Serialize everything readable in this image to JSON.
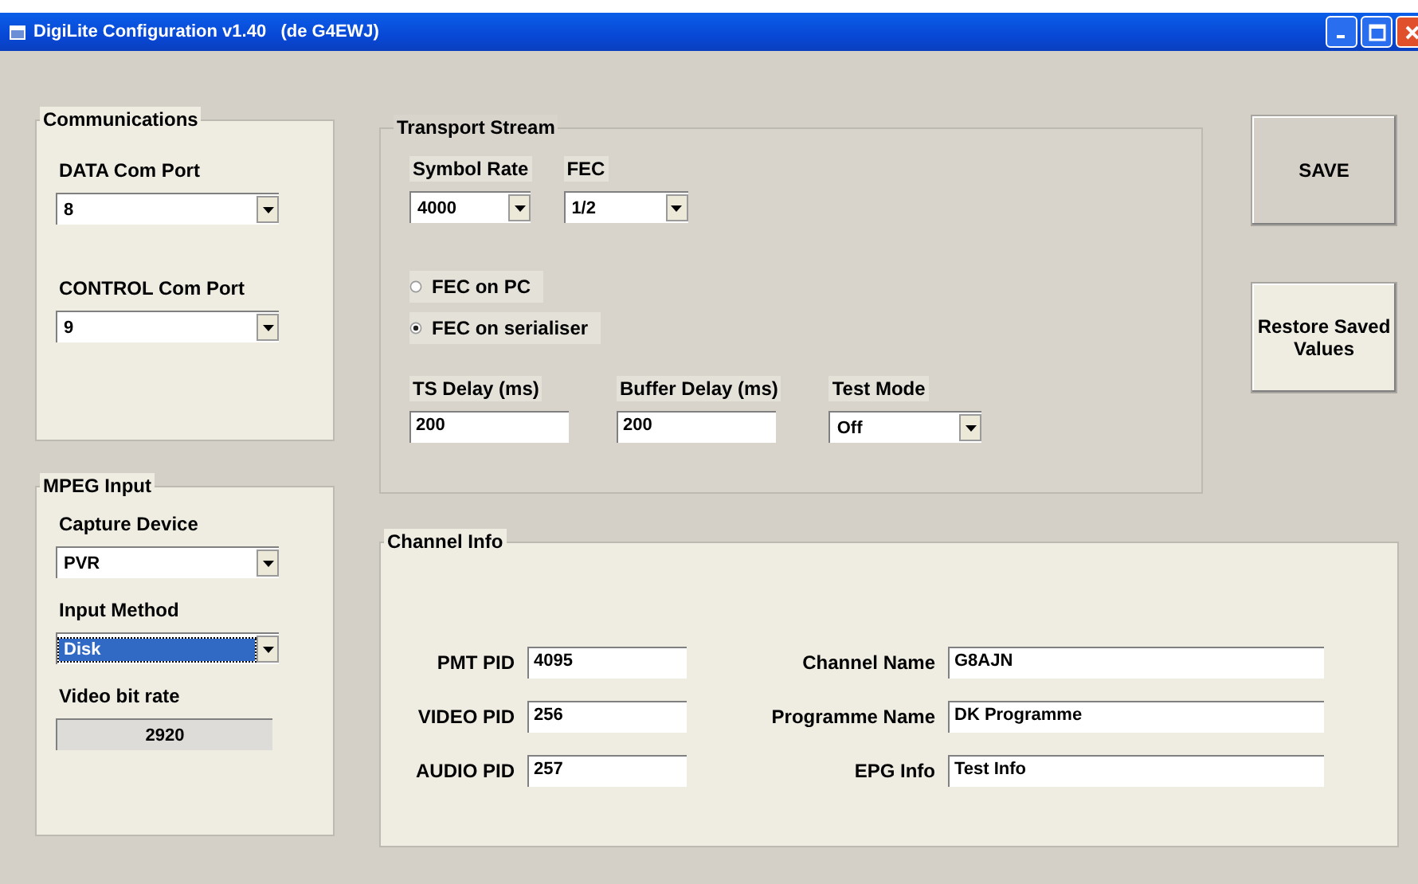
{
  "window": {
    "title": "DigiLite Configuration v1.40   (de G4EWJ)"
  },
  "communications": {
    "title": "Communications",
    "fields": [
      {
        "label": "DATA Com Port",
        "value": "8",
        "kind": "dropdown"
      },
      {
        "label": "CONTROL Com Port",
        "value": "9",
        "kind": "dropdown"
      }
    ]
  },
  "mpeg_input": {
    "title": "MPEG Input",
    "fields": [
      {
        "label": "Capture Device",
        "value": "PVR",
        "kind": "dropdown"
      },
      {
        "label": "Input Method",
        "value": "Disk",
        "kind": "dropdown",
        "focused": true
      },
      {
        "label": "Video bit rate",
        "value": "2920",
        "kind": "readout"
      }
    ]
  },
  "transport_stream": {
    "title": "Transport Stream",
    "top_fields": [
      {
        "label": "Symbol Rate",
        "value": "4000",
        "kind": "dropdown"
      },
      {
        "label": "FEC",
        "value": "1/2",
        "kind": "dropdown"
      }
    ],
    "fec_options": [
      {
        "label": "FEC on PC",
        "selected": false
      },
      {
        "label": "FEC on serialiser",
        "selected": true
      }
    ],
    "bottom_fields": [
      {
        "label": "TS Delay (ms)",
        "value": "200",
        "kind": "text"
      },
      {
        "label": "Buffer Delay (ms)",
        "value": "200",
        "kind": "text"
      },
      {
        "label": "Test Mode",
        "value": "Off",
        "kind": "dropdown"
      }
    ]
  },
  "buttons": [
    {
      "label": "SAVE",
      "hovered": false
    },
    {
      "label": "Restore Saved Values",
      "hovered": true
    }
  ],
  "channel_info": {
    "title": "Channel Info",
    "left_fields": [
      {
        "label": "PMT PID",
        "value": "4095"
      },
      {
        "label": "VIDEO PID",
        "value": "256"
      },
      {
        "label": "AUDIO PID",
        "value": "257"
      }
    ],
    "right_fields": [
      {
        "label": "Channel Name",
        "value": "G8AJN"
      },
      {
        "label": "Programme Name",
        "value": "DK Programme"
      },
      {
        "label": "EPG Info",
        "value": "Test Info"
      }
    ]
  }
}
